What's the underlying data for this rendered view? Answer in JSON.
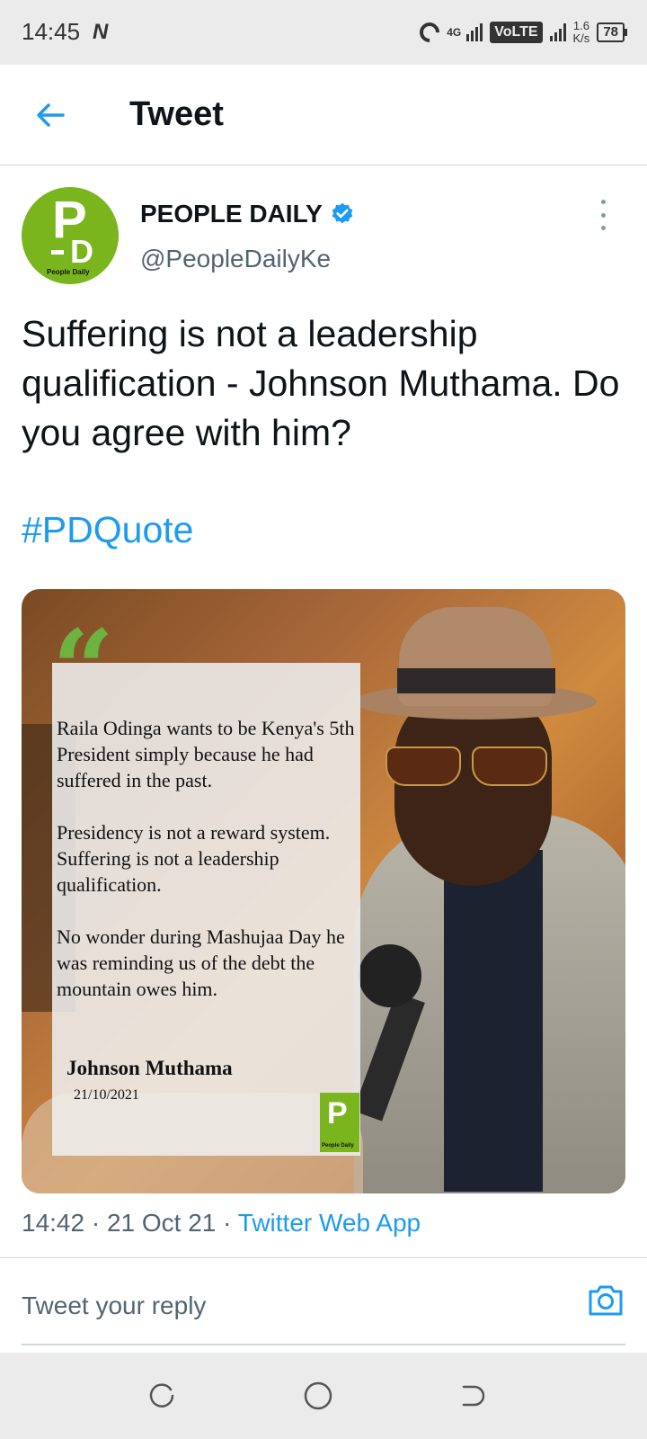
{
  "status_bar": {
    "time": "14:45",
    "network_type": "4G",
    "volte": "VoLTE",
    "speed_value": "1.6",
    "speed_unit": "K/s",
    "battery": "78"
  },
  "header": {
    "title": "Tweet"
  },
  "tweet": {
    "display_name": "PEOPLE DAILY",
    "handle": "@PeopleDailyKe",
    "text": "Suffering is not a leadership qualification - Johnson Muthama. Do you agree with him?",
    "hashtag": "#PDQuote",
    "avatar_caption": "People Daily",
    "media": {
      "quote_paragraphs": [
        "Raila Odinga wants to be Kenya's 5th President simply because he had suffered in the past.",
        "Presidency is not a reward system. Suffering is not a leadership qualification.",
        "No wonder during Mashujaa Day he was reminding us of the debt the mountain owes him."
      ],
      "author": "Johnson Muthama",
      "date": "21/10/2021",
      "logo_caption": "People Daily"
    },
    "meta": {
      "time": "14:42",
      "date": "21 Oct 21",
      "separator": "·",
      "source": "Twitter Web App"
    }
  },
  "reply": {
    "placeholder": "Tweet your reply"
  },
  "icons": {
    "back": "arrow-left-icon",
    "verified": "verified-badge-icon",
    "more": "more-vertical-icon",
    "camera": "camera-icon",
    "nav_recents": "recents-icon",
    "nav_home": "home-circle-icon",
    "nav_back": "back-gesture-icon"
  },
  "colors": {
    "accent": "#1d9bf0",
    "brand_green": "#7ab51d",
    "text_secondary": "#536471"
  }
}
